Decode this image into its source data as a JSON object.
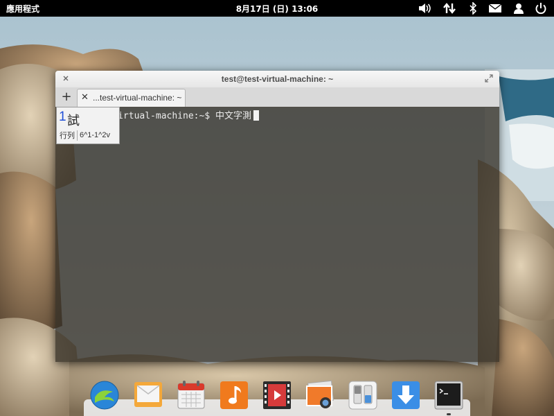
{
  "top_panel": {
    "applications_label": "應用程式",
    "clock": "8月17日 (日) 13:06",
    "indicators": [
      "volume-icon",
      "network-icon",
      "bluetooth-icon",
      "mail-icon",
      "user-icon",
      "power-icon"
    ]
  },
  "terminal": {
    "title": "test@test-virtual-machine: ~",
    "tab_label": "...test-virtual-machine: ~",
    "new_tab_symbol": "+",
    "tab_close_symbol": "✕",
    "prompt_line": "test@test-virtual-machine:~$ 中文字測"
  },
  "ime": {
    "candidate_index": "1",
    "candidate": "試",
    "status_label": "行列",
    "status_code": "6^1-1^2v"
  },
  "dock": {
    "items": [
      "midori-browser-icon",
      "mail-app-icon",
      "calendar-icon",
      "music-icon",
      "video-player-icon",
      "photos-icon",
      "settings-switches-icon",
      "software-center-icon",
      "terminal-icon"
    ],
    "active_item": "terminal-icon"
  },
  "colors": {
    "panel": "#000000",
    "terminal_bg": "#343026",
    "ime_highlight": "#1f4fd8"
  }
}
